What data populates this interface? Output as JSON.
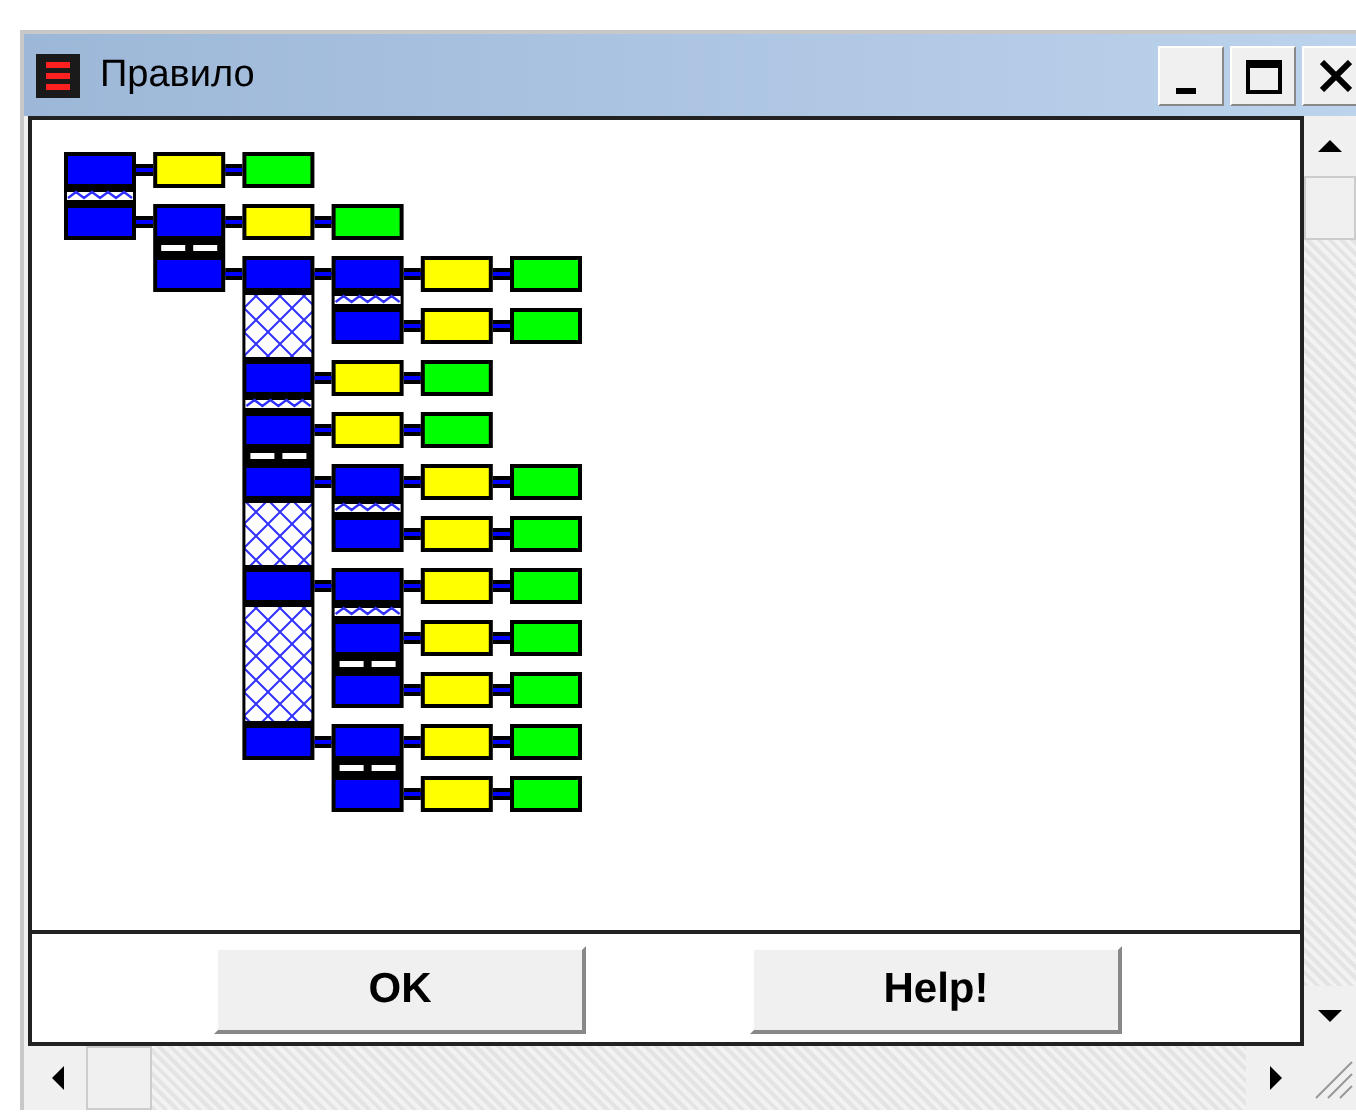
{
  "window": {
    "title": "Правило"
  },
  "buttons": [
    {
      "label": "OK"
    },
    {
      "label": "Help!"
    }
  ]
}
